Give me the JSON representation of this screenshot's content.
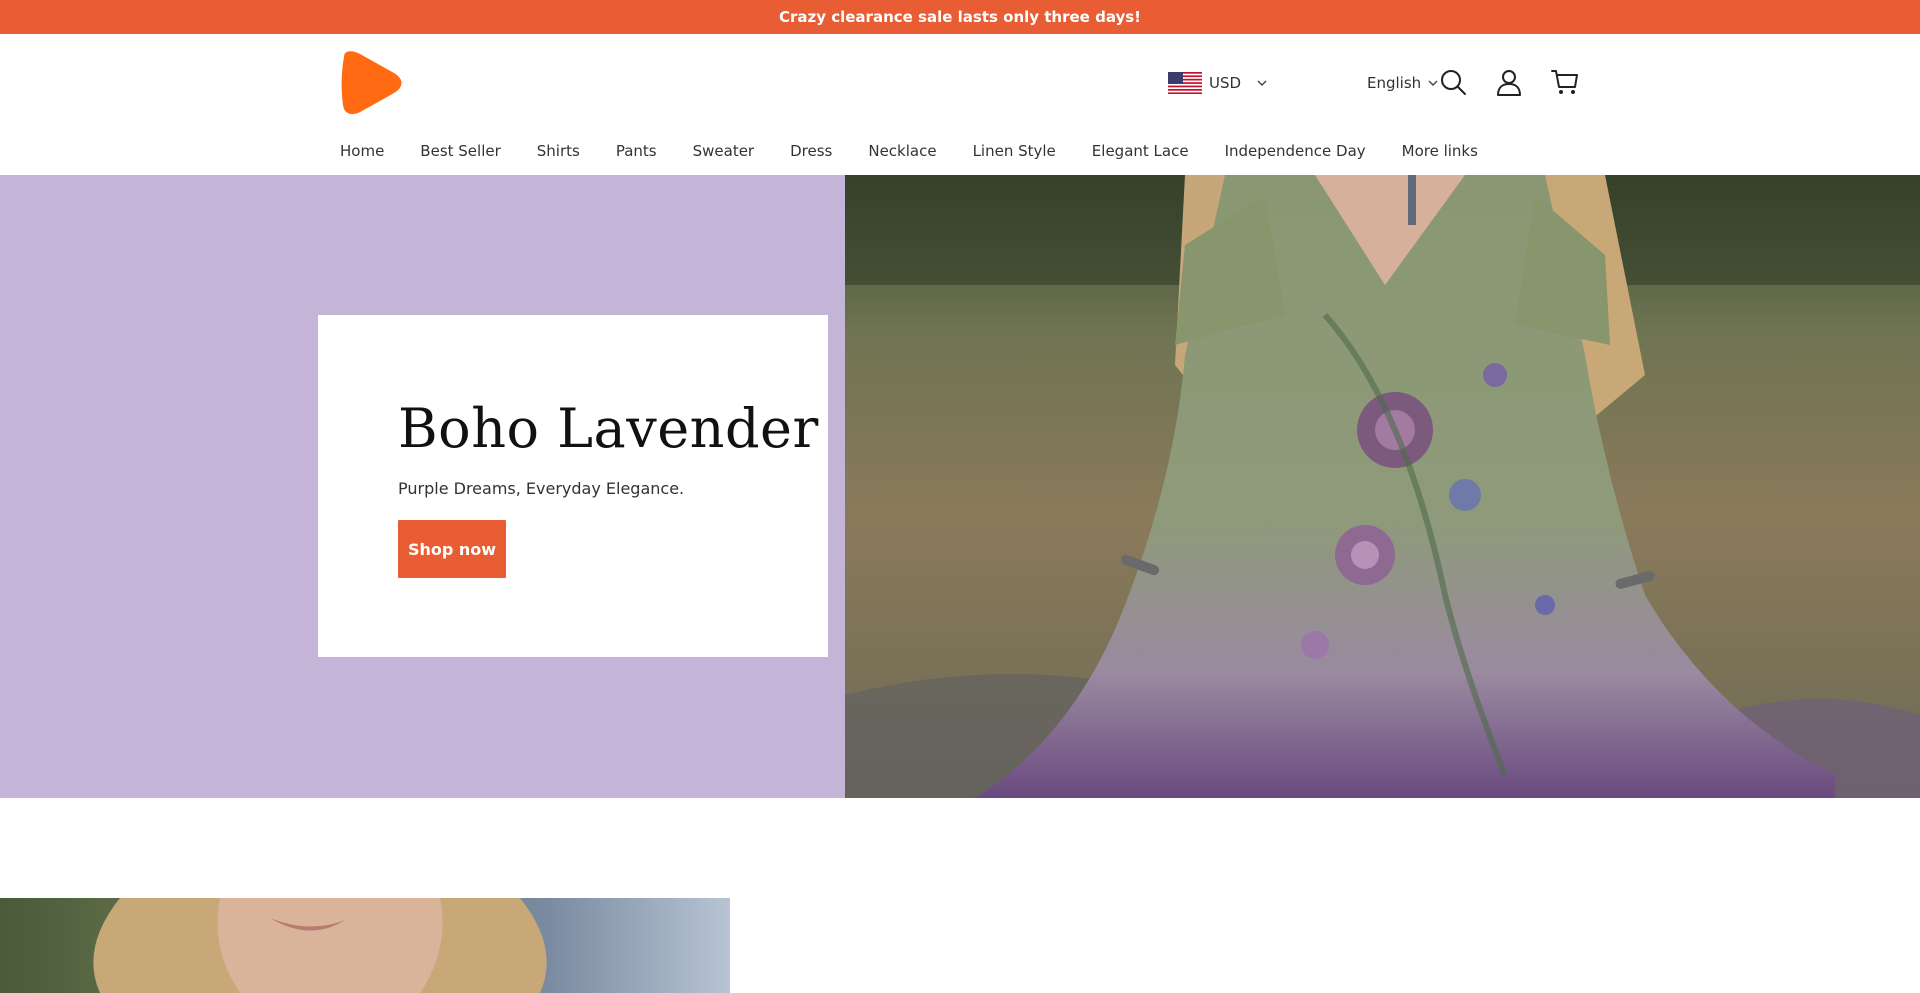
{
  "announcement": {
    "text": "Crazy clearance sale lasts only three days!"
  },
  "header": {
    "currency": {
      "code": "USD",
      "flag_icon": "us-flag-icon"
    },
    "language": "English",
    "icons": [
      "search-icon",
      "user-icon",
      "cart-icon"
    ]
  },
  "nav": {
    "items": [
      {
        "label": "Home"
      },
      {
        "label": "Best Seller"
      },
      {
        "label": "Shirts"
      },
      {
        "label": "Pants"
      },
      {
        "label": "Sweater"
      },
      {
        "label": "Dress"
      },
      {
        "label": "Necklace"
      },
      {
        "label": "Linen Style"
      },
      {
        "label": "Elegant Lace"
      },
      {
        "label": "Independence Day"
      },
      {
        "label": "More links"
      }
    ]
  },
  "hero": {
    "title": "Boho Lavender",
    "subtitle": "Purple Dreams, Everyday Elegance.",
    "button_label": "Shop now",
    "panel_color": "#c4b4d7",
    "accent_color": "#e85d33"
  }
}
